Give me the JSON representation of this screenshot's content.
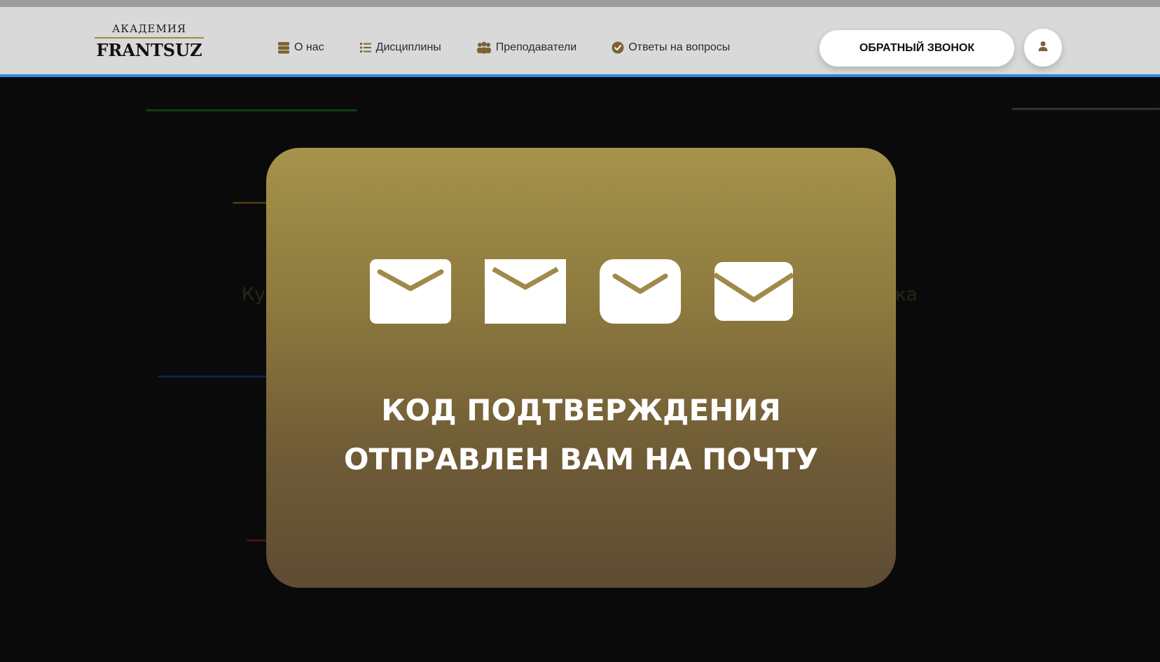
{
  "header": {
    "logo": {
      "top": "АКАДЕМИЯ",
      "main": "FRANTSUZ"
    },
    "nav": [
      {
        "label": "О нас",
        "icon": "layers-icon"
      },
      {
        "label": "Дисциплины",
        "icon": "list-icon"
      },
      {
        "label": "Преподаватели",
        "icon": "users-icon"
      },
      {
        "label": "Ответы на вопросы",
        "icon": "check-circle-icon"
      }
    ],
    "callback_label": "ОБРАТНЫЙ ЗВОНОК",
    "user_icon": "user-icon"
  },
  "background": {
    "text_left": "Ку",
    "text_right": "ка"
  },
  "modal": {
    "icons": [
      "mail-icon",
      "mail-icon",
      "mail-icon",
      "mail-icon"
    ],
    "line1": "КОД ПОДТВЕРЖДЕНИЯ",
    "line2": "ОТПРАВЛЕН ВАМ НА ПОЧТУ"
  },
  "colors": {
    "accent_gold": "#a6934c",
    "icon_gold": "#7a6335",
    "header_bg": "#d9d9d9",
    "header_border": "#2a8ee8"
  }
}
